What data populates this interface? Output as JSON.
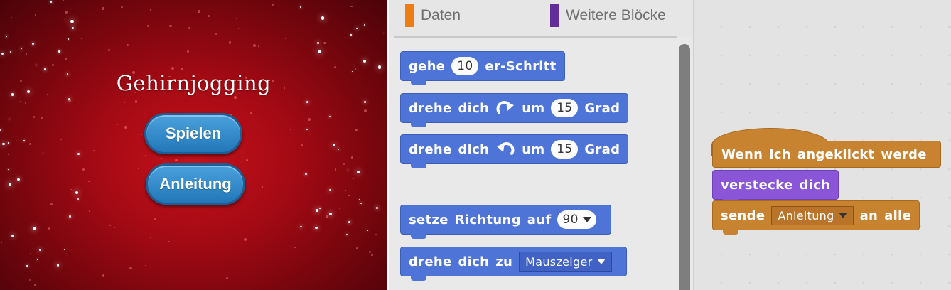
{
  "stage": {
    "title": "Gehirnjogging",
    "play_button": "Spielen",
    "guide_button": "Anleitung"
  },
  "palette": {
    "categories": [
      {
        "label": "Daten",
        "color": "#ee7d16"
      },
      {
        "label": "Weitere Blöcke",
        "color": "#632d99"
      }
    ],
    "blocks": {
      "move": {
        "words": [
          "gehe"
        ],
        "value": "10",
        "suffix": "er-Schritt"
      },
      "turn_right": {
        "w1": "drehe",
        "w2": "dich",
        "w3": "um",
        "value": "15",
        "suffix": "Grad",
        "icon": "rotate-clockwise-icon"
      },
      "turn_left": {
        "w1": "drehe",
        "w2": "dich",
        "w3": "um",
        "value": "15",
        "suffix": "Grad",
        "icon": "rotate-counterclockwise-icon"
      },
      "point_direction": {
        "w1": "setze",
        "w2": "Richtung",
        "w3": "auf",
        "value": "90"
      },
      "point_towards": {
        "w1": "drehe",
        "w2": "dich",
        "w3": "zu",
        "value": "Mauszeiger"
      }
    }
  },
  "scripts": {
    "hat": {
      "w1": "Wenn",
      "w2": "ich",
      "w3": "angeklickt",
      "w4": "werde"
    },
    "hide": {
      "w1": "verstecke",
      "w2": "dich"
    },
    "broadcast": {
      "w1": "sende",
      "value": "Anleitung",
      "w2": "an",
      "w3": "alle"
    }
  },
  "colors": {
    "motion": "#4d74d6",
    "looks": "#8a55d7",
    "events": "#c88330",
    "stage_background": "#a50a14",
    "stage_button": "#2f86c8"
  }
}
